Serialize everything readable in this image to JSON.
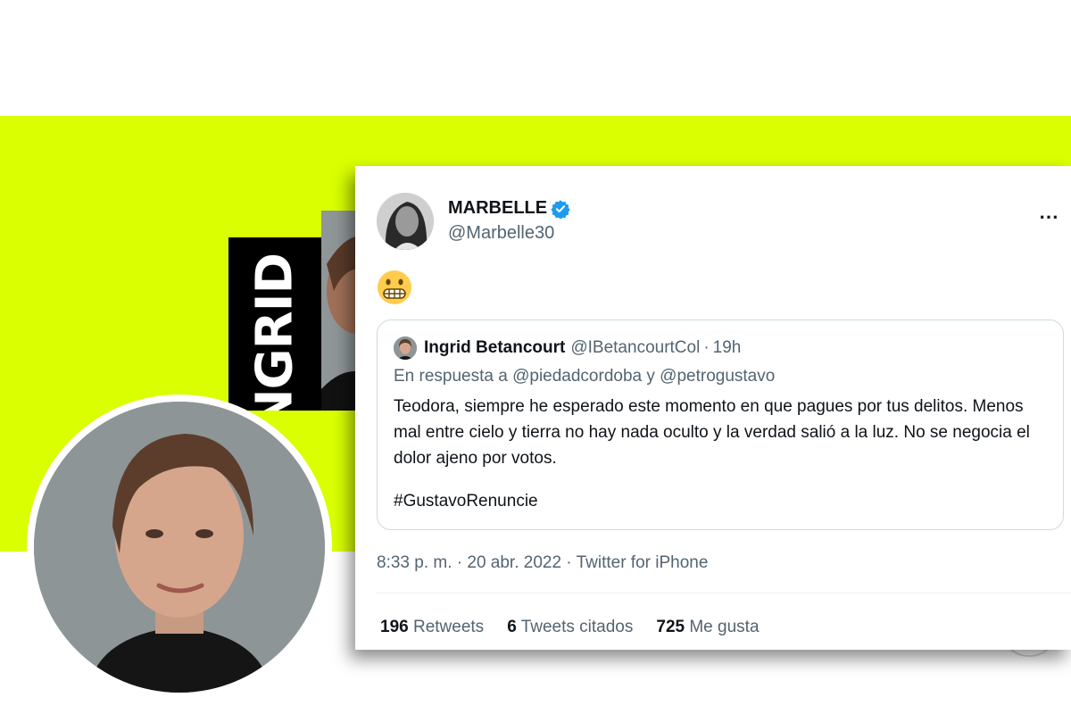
{
  "banner": {
    "color": "#d9ff00",
    "poster_text": "INGRID"
  },
  "tweet": {
    "author_name": "MARBELLE",
    "author_handle": "@Marbelle30",
    "verified": true,
    "more_icon": "more-icon",
    "more_label": "⋯",
    "emoji": "grimacing-face-emoji",
    "quoted": {
      "author_name": "Ingrid Betancourt",
      "author_handle": "@IBetancourtCol",
      "separator": "·",
      "time": "19h",
      "reply_prefix": "En respuesta a",
      "reply_mention_1": "@piedadcordoba",
      "reply_joiner": "y",
      "reply_mention_2": "@petrogustavo",
      "body": "Teodora, siempre he esperado este momento en que pagues por tus delitos. Menos mal entre cielo y tierra no hay nada oculto y la verdad salió a la luz. No se negocia el dolor ajeno por votos.",
      "hashtag": "#GustavoRenuncie"
    },
    "meta": "8:33 p. m. · 20 abr. 2022 · Twitter for iPhone",
    "stats": {
      "retweets_count": "196",
      "retweets_label": "Retweets",
      "quotes_count": "6",
      "quotes_label": "Tweets citados",
      "likes_count": "725",
      "likes_label": "Me gusta"
    },
    "colors": {
      "verified": "#1d9bf0",
      "secondary_text": "#536471",
      "primary_text": "#0f1419"
    }
  }
}
